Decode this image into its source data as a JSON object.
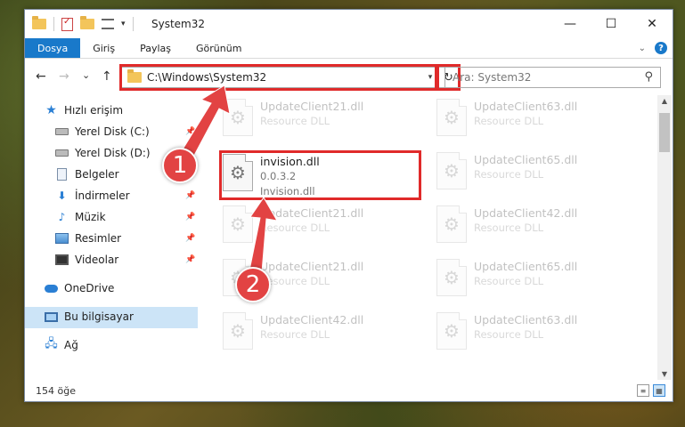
{
  "window": {
    "title": "System32",
    "controls": {
      "minimize": "—",
      "maximize": "☐",
      "close": "✕"
    }
  },
  "ribbon": {
    "tabs": [
      {
        "label": "Dosya",
        "active": true
      },
      {
        "label": "Giriş"
      },
      {
        "label": "Paylaş"
      },
      {
        "label": "Görünüm"
      }
    ],
    "help": "?"
  },
  "navbar": {
    "back": "←",
    "forward": "→",
    "recent": "⌄",
    "up": "↑",
    "address": "C:\\Windows\\System32",
    "refresh": "↻",
    "search_placeholder": "Ara: System32"
  },
  "sidebar": {
    "items": [
      {
        "label": "Hızlı erişim",
        "icon": "star-icon"
      },
      {
        "label": "Yerel Disk (C:)",
        "icon": "drive-icon",
        "pinned": true
      },
      {
        "label": "Yerel Disk (D:)",
        "icon": "drive-icon"
      },
      {
        "label": "Belgeler",
        "icon": "documents-icon",
        "pinned": true
      },
      {
        "label": "İndirmeler",
        "icon": "downloads-icon",
        "pinned": true
      },
      {
        "label": "Müzik",
        "icon": "music-icon",
        "pinned": true
      },
      {
        "label": "Resimler",
        "icon": "pictures-icon",
        "pinned": true
      },
      {
        "label": "Videolar",
        "icon": "videos-icon",
        "pinned": true
      },
      {
        "label": "OneDrive",
        "icon": "cloud-icon"
      },
      {
        "label": "Bu bilgisayar",
        "icon": "computer-icon",
        "selected": true
      },
      {
        "label": "Ağ",
        "icon": "network-icon"
      }
    ]
  },
  "files": {
    "highlighted": {
      "name": "invision.dll",
      "version": "0.0.3.2",
      "desc": "Invision.dll"
    },
    "left": [
      {
        "name": "UpdateClient21.dll",
        "desc": "Resource DLL"
      },
      {
        "name": "UpdateClient21.dll",
        "desc": "Resource DLL"
      },
      {
        "name": "UpdateClient21.dll",
        "desc": "Resource DLL"
      },
      {
        "name": "UpdateClient42.dll",
        "desc": "Resource DLL"
      }
    ],
    "right": [
      {
        "name": "UpdateClient63.dll",
        "desc": "Resource DLL"
      },
      {
        "name": "UpdateClient65.dll",
        "desc": "Resource DLL"
      },
      {
        "name": "UpdateClient42.dll",
        "desc": "Resource DLL"
      },
      {
        "name": "UpdateClient65.dll",
        "desc": "Resource DLL"
      },
      {
        "name": "UpdateClient63.dll",
        "desc": "Resource DLL"
      }
    ]
  },
  "status": {
    "count": "154 öğe"
  },
  "callouts": {
    "one": "1",
    "two": "2"
  },
  "colors": {
    "accent": "#1979ca",
    "highlight_border": "#e02a2a",
    "callout": "#e24343"
  }
}
